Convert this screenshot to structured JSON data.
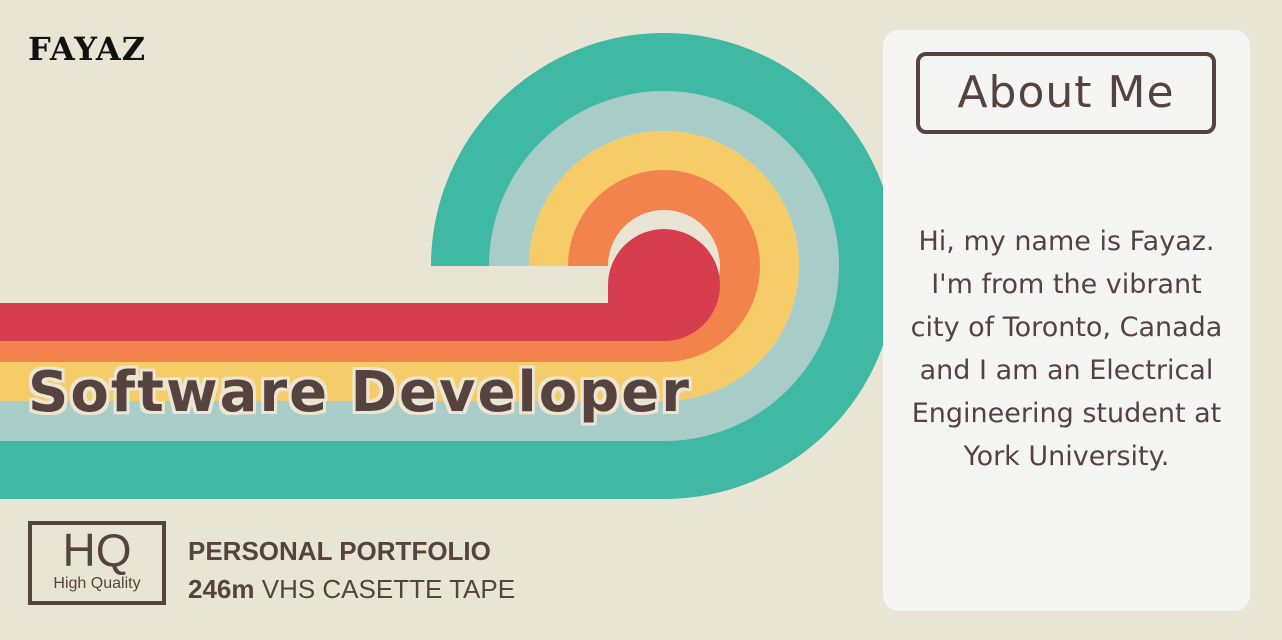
{
  "brand": "FAYAZ",
  "hero": {
    "title": "Software Developer",
    "stripe_colors": [
      "#3fb8a4",
      "#a8ccc7",
      "#f6cc68",
      "#f2834d",
      "#d63e50"
    ]
  },
  "badge": {
    "big": "HQ",
    "small": "High Quality"
  },
  "tape": {
    "line1": "PERSONAL PORTFOLIO",
    "length": "246m",
    "line2_rest": " VHS CASETTE TAPE"
  },
  "about": {
    "title": "About Me",
    "text": "Hi, my name is Fayaz. I'm from the vibrant city of Toronto, Canada and I am an Electrical Engineering student at York University."
  },
  "colors": {
    "background": "#e9e5d4",
    "text_brown": "#56433f",
    "card_bg": "#f5f5f3"
  }
}
